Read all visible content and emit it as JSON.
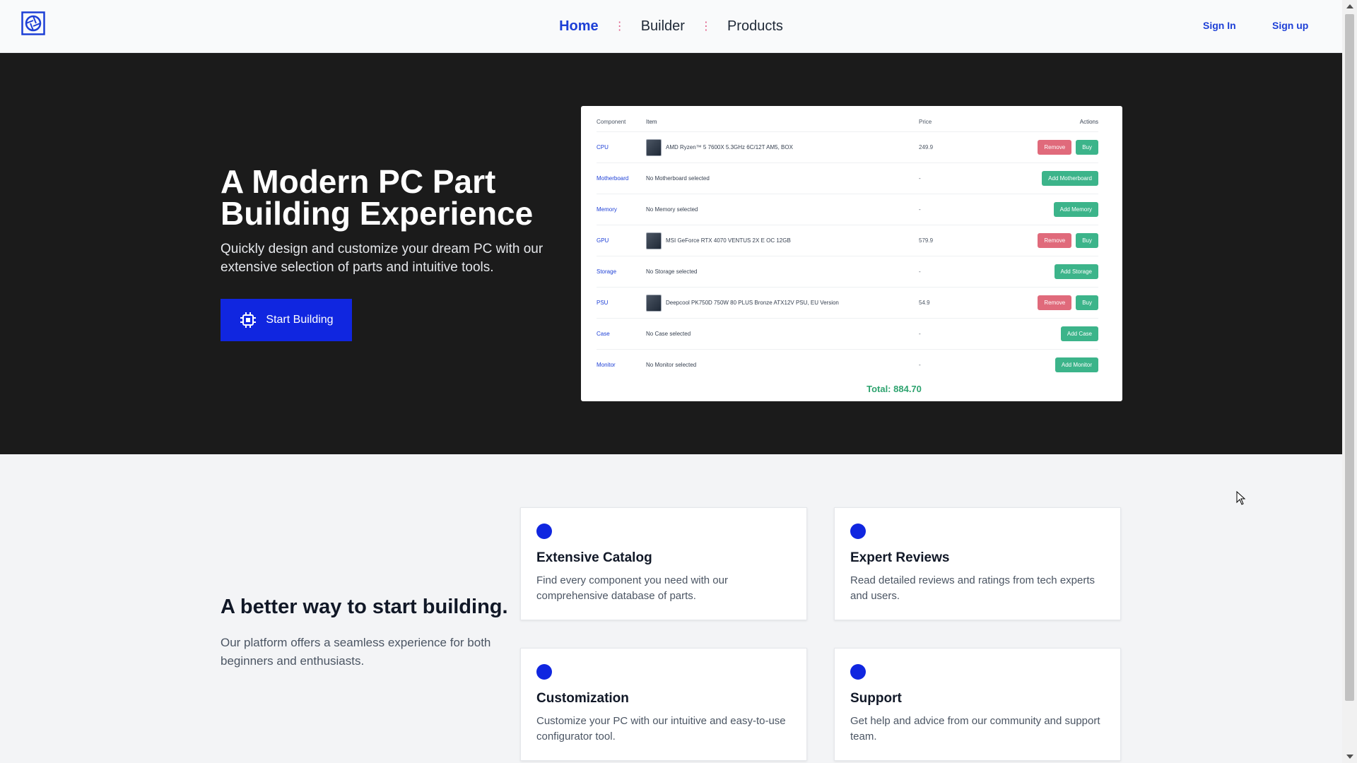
{
  "nav": {
    "logo_icon": "aperture-logo-icon",
    "links": [
      {
        "label": "Home",
        "active": true
      },
      {
        "label": "Builder",
        "active": false
      },
      {
        "label": "Products",
        "active": false
      }
    ],
    "separator": "⋮",
    "sign_in": "Sign In",
    "sign_up": "Sign up"
  },
  "hero": {
    "title": "A Modern PC Part Building Experience",
    "subtitle": "Quickly design and customize your dream PC with our extensive selection of parts and intuitive tools.",
    "cta_label": "Start Building",
    "cta_icon": "cpu-chip-icon"
  },
  "builder": {
    "headers": {
      "component": "Component",
      "item": "Item",
      "price": "Price",
      "actions": "Actions"
    },
    "rows": [
      {
        "component": "CPU",
        "item": "AMD Ryzen™ 5 7600X 5.3GHz 6C/12T AM5, BOX",
        "price": "249.9",
        "has_item": true,
        "remove": "Remove",
        "buy": "Buy"
      },
      {
        "component": "Motherboard",
        "item": "No Motherboard selected",
        "price": "-",
        "has_item": false,
        "add": "Add Motherboard"
      },
      {
        "component": "Memory",
        "item": "No Memory selected",
        "price": "-",
        "has_item": false,
        "add": "Add Memory"
      },
      {
        "component": "GPU",
        "item": "MSI GeForce RTX 4070 VENTUS 2X E OC 12GB",
        "price": "579.9",
        "has_item": true,
        "remove": "Remove",
        "buy": "Buy"
      },
      {
        "component": "Storage",
        "item": "No Storage selected",
        "price": "-",
        "has_item": false,
        "add": "Add Storage"
      },
      {
        "component": "PSU",
        "item": "Deepcool PK750D 750W 80 PLUS Bronze ATX12V PSU, EU Version",
        "price": "54.9",
        "has_item": true,
        "remove": "Remove",
        "buy": "Buy"
      },
      {
        "component": "Case",
        "item": "No Case selected",
        "price": "-",
        "has_item": false,
        "add": "Add Case"
      },
      {
        "component": "Monitor",
        "item": "No Monitor selected",
        "price": "-",
        "has_item": false,
        "add": "Add Monitor"
      }
    ],
    "total": "Total: 884.70"
  },
  "features": {
    "title": "A better way to start building.",
    "subtitle": "Our platform offers a seamless experience for both beginners and enthusiasts.",
    "cards": [
      {
        "title": "Extensive Catalog",
        "text": "Find every component you need with our comprehensive database of parts."
      },
      {
        "title": "Expert Reviews",
        "text": "Read detailed reviews and ratings from tech experts and users."
      },
      {
        "title": "Customization",
        "text": "Customize your PC with our intuitive and easy-to-use configurator tool."
      },
      {
        "title": "Support",
        "text": "Get help and advice from our community and support team."
      }
    ]
  },
  "colors": {
    "accent": "#1026e0",
    "hero_bg": "#1b1b1b",
    "remove": "#e06a7b",
    "buy": "#3cb48a"
  }
}
